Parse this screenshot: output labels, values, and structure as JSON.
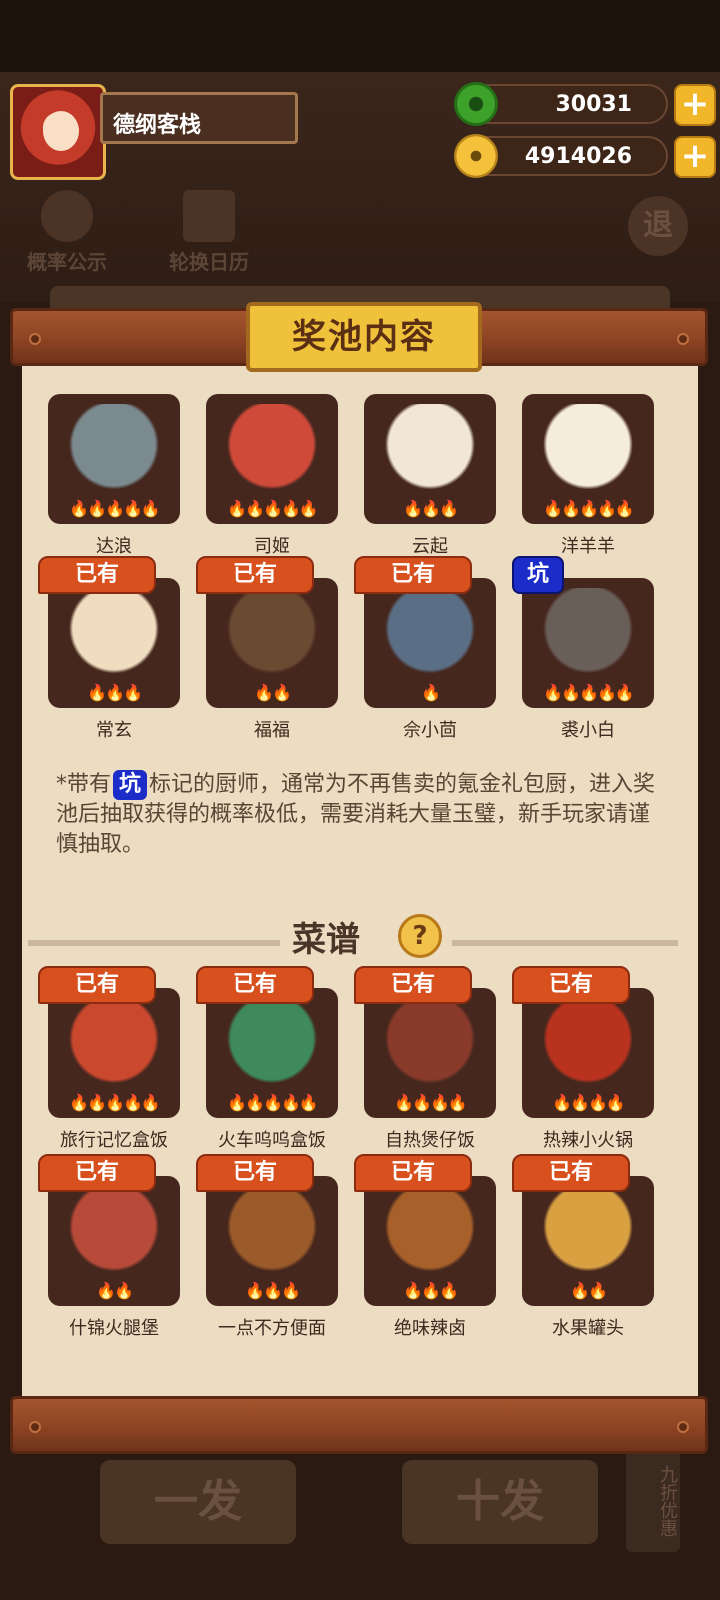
{
  "player": {
    "name": "德纲客栈"
  },
  "currency": {
    "jade": "30031",
    "gold": "4914026",
    "plus": "+"
  },
  "hud": {
    "probability": "概率公示",
    "calendar": "轮换日历",
    "exit": "退"
  },
  "modal": {
    "title": "奖池内容",
    "chefs_partial": [
      {
        "name": "达浪",
        "flames": 5,
        "art_color": "#7a8a8f"
      },
      {
        "name": "司姬",
        "flames": 5,
        "art_color": "#d04a3a"
      },
      {
        "name": "云起",
        "flames": 3,
        "art_color": "#f1e7d4"
      },
      {
        "name": "洋羊羊",
        "flames": 5,
        "art_color": "#f6ecdc"
      }
    ],
    "chefs": [
      {
        "name": "常玄",
        "tag": "已有",
        "flames": 3,
        "art_color": "#f0ddc0"
      },
      {
        "name": "福福",
        "tag": "已有",
        "flames": 2,
        "art_color": "#6b4a32"
      },
      {
        "name": "佘小茴",
        "tag": "已有",
        "flames": 1,
        "art_color": "#5a6e85"
      },
      {
        "name": "裘小白",
        "tag": "坑",
        "flames": 5,
        "art_color": "#6a5e58"
      }
    ],
    "note_prefix": "*带有",
    "note_pit": "坑",
    "note_text": "标记的厨师，通常为不再售卖的氪金礼包厨，进入奖池后抽取获得的概率极低，需要消耗大量玉璧，新手玩家请谨慎抽取。",
    "recipes_title": "菜谱",
    "help": "?",
    "recipes": [
      {
        "name": "旅行记忆盒饭",
        "tag": "已有",
        "flames": 5,
        "art_color": "#c9482e"
      },
      {
        "name": "火车呜呜盒饭",
        "tag": "已有",
        "flames": 5,
        "art_color": "#3e8a5a"
      },
      {
        "name": "自热煲仔饭",
        "tag": "已有",
        "flames": 4,
        "art_color": "#8a3a2a"
      },
      {
        "name": "热辣小火锅",
        "tag": "已有",
        "flames": 4,
        "art_color": "#b8321e"
      },
      {
        "name": "什锦火腿堡",
        "tag": "已有",
        "flames": 2,
        "art_color": "#b84a3a"
      },
      {
        "name": "一点不方便面",
        "tag": "已有",
        "flames": 3,
        "art_color": "#9a5a2a"
      },
      {
        "name": "绝味辣卤",
        "tag": "已有",
        "flames": 3,
        "art_color": "#a8602a"
      },
      {
        "name": "水果罐头",
        "tag": "已有",
        "flames": 2,
        "art_color": "#d9a042"
      }
    ]
  },
  "background": {
    "btn1": "一发",
    "btn2": "十发",
    "discount": "九折优惠"
  }
}
